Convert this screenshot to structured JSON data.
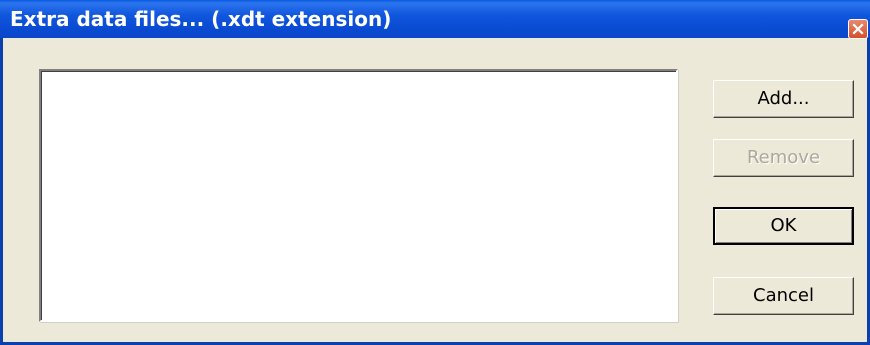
{
  "window": {
    "title": "Extra data files... (.xdt extension)"
  },
  "file_list": {
    "items": []
  },
  "buttons": {
    "add_label": "Add...",
    "remove_label": "Remove",
    "remove_enabled": false,
    "ok_label": "OK",
    "cancel_label": "Cancel"
  },
  "icons": {
    "close": "close-icon"
  },
  "colors": {
    "titlebar": "#0a4bd2",
    "dialog_background": "#ece9d8",
    "close_button": "#d6502c"
  }
}
